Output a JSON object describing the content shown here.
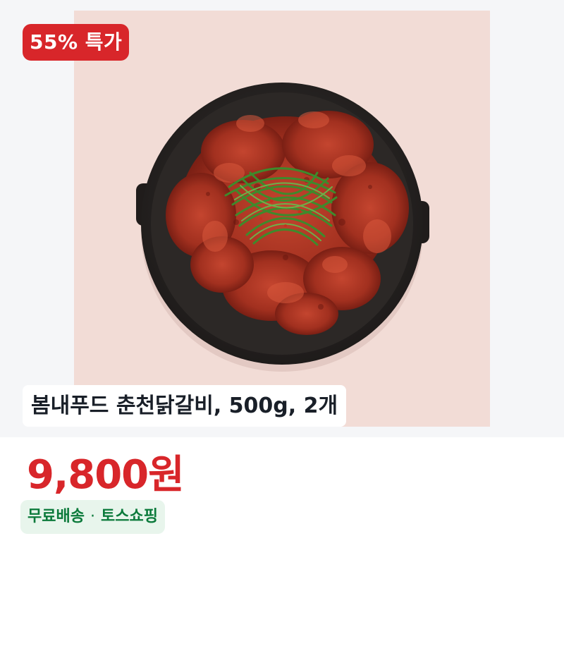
{
  "product": {
    "image_icon": "spicy-chicken-galbi-dish-image",
    "discount_badge": "55% 특가",
    "title": "봄내푸드 춘천닭갈비, 500g, 2개",
    "price": "9,800원",
    "shipping_label": "무료배송",
    "separator": "·",
    "store_label": "토스쇼핑"
  },
  "colors": {
    "accent_red": "#d8262a",
    "shipping_green": "#0b7a3b",
    "shipping_bg": "#e8f5ec"
  }
}
